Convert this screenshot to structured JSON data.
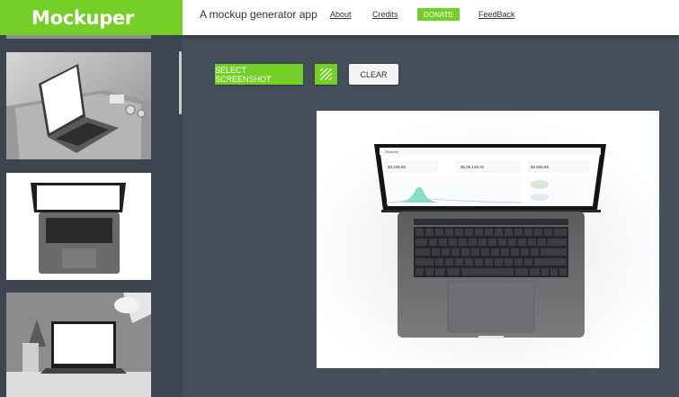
{
  "app": {
    "brand": "Mockuper",
    "tagline": "A mockup generator app"
  },
  "nav": {
    "about": "About",
    "credits": "Credits",
    "donate": "DONATE",
    "feedback": "FeedBack"
  },
  "toolbar": {
    "select_label": "SELECT SCREENSHOT",
    "clear_label": "CLEAR",
    "pattern_icon": "pattern-icon"
  },
  "colors": {
    "accent": "#74cf27",
    "sidebar": "#3d4650",
    "main_bg": "#454f5a"
  },
  "mockup_screen": {
    "stat1": "$3,238,88",
    "stat2": "$5,05,148,31",
    "stat3": "$3 605,89"
  }
}
